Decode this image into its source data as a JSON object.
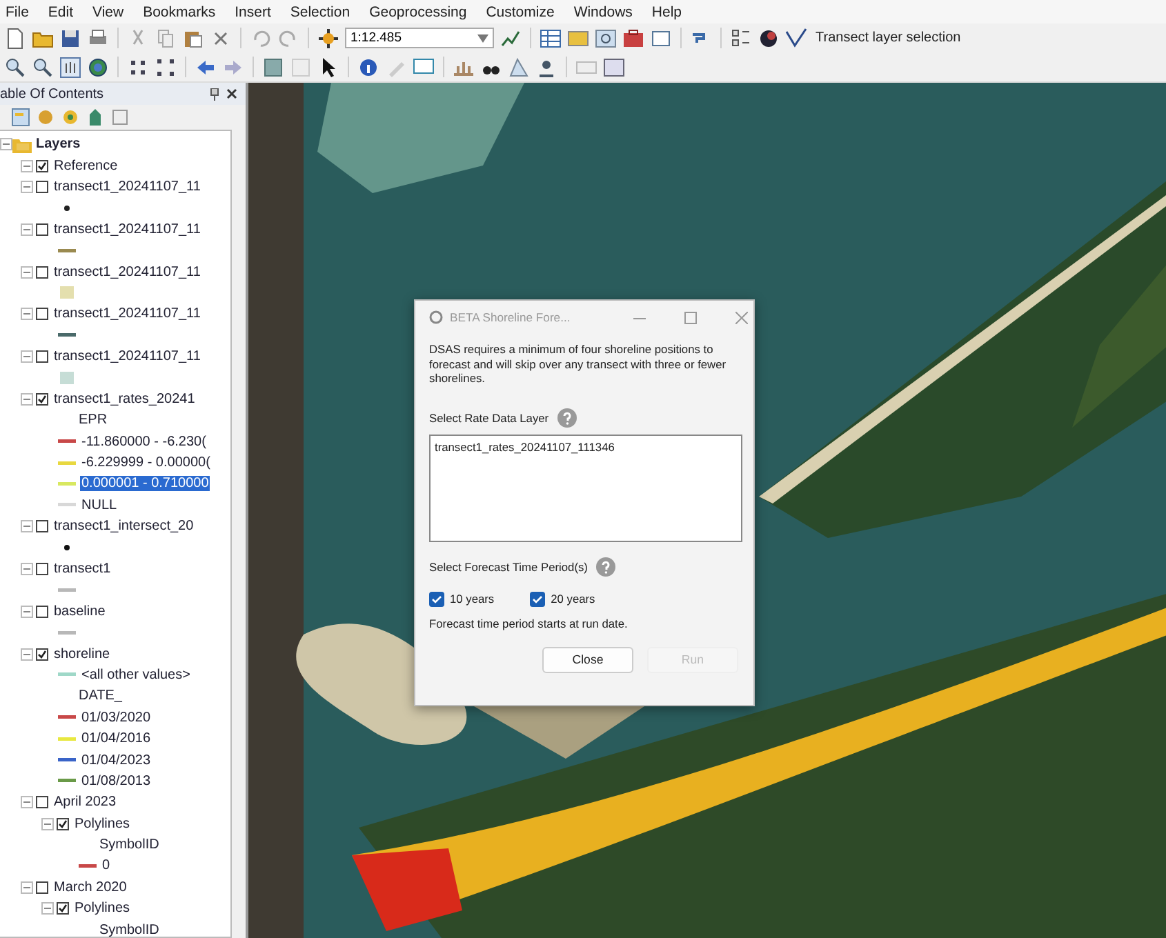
{
  "menu": [
    "File",
    "Edit",
    "View",
    "Bookmarks",
    "Insert",
    "Selection",
    "Geoprocessing",
    "Customize",
    "Windows",
    "Help"
  ],
  "toolbar": {
    "scale": "1:12.485",
    "tool_label": "Transect layer selection"
  },
  "toc": {
    "title": "able Of Contents",
    "layers": [
      {
        "kind": "group",
        "label": "Layers",
        "children": [
          {
            "kind": "layer",
            "label": "Reference",
            "checked": true
          },
          {
            "kind": "layer",
            "label": "transect1_20241107_11",
            "checked": false,
            "children": [
              {
                "kind": "dot",
                "color": "#222222"
              }
            ]
          },
          {
            "kind": "layer",
            "label": "transect1_20241107_11",
            "checked": false,
            "children": [
              {
                "kind": "line",
                "color": "#9a8a50"
              }
            ]
          },
          {
            "kind": "layer",
            "label": "transect1_20241107_11",
            "checked": false,
            "children": [
              {
                "kind": "patch",
                "color": "#e4dfae"
              }
            ]
          },
          {
            "kind": "layer",
            "label": "transect1_20241107_11",
            "checked": false,
            "children": [
              {
                "kind": "line",
                "color": "#4a6a6a"
              }
            ]
          },
          {
            "kind": "layer",
            "label": "transect1_20241107_11",
            "checked": false,
            "children": [
              {
                "kind": "patch",
                "color": "#c6ddd6"
              }
            ]
          },
          {
            "kind": "layer",
            "label": "transect1_rates_20241",
            "checked": true,
            "children": [
              {
                "kind": "field",
                "label": "EPR",
                "selected": false
              },
              {
                "kind": "line",
                "label": "-11.860000 - -6.230(",
                "color": "#c84848",
                "selected": false
              },
              {
                "kind": "line",
                "label": "-6.229999 - 0.00000(",
                "color": "#e8d840",
                "selected": false
              },
              {
                "kind": "line",
                "label": "0.000001 - 0.710000",
                "color": "#d8e860",
                "selected": true
              },
              {
                "kind": "line",
                "label": "NULL",
                "color": "#d8d8d8",
                "selected": false
              }
            ]
          },
          {
            "kind": "layer",
            "label": "transect1_intersect_20",
            "checked": false,
            "children": [
              {
                "kind": "dot",
                "color": "#111111"
              }
            ]
          },
          {
            "kind": "layer",
            "label": "transect1",
            "checked": false,
            "children": [
              {
                "kind": "line",
                "color": "#b8b8b8"
              }
            ]
          },
          {
            "kind": "layer",
            "label": "baseline",
            "checked": false,
            "children": [
              {
                "kind": "line",
                "color": "#b8b8b8"
              }
            ]
          },
          {
            "kind": "layer",
            "label": "shoreline",
            "checked": true,
            "children": [
              {
                "kind": "line",
                "label": "<all other values>",
                "color": "#9fd8c8"
              },
              {
                "kind": "field",
                "label": "DATE_"
              },
              {
                "kind": "line",
                "label": "01/03/2020",
                "color": "#c84848"
              },
              {
                "kind": "line",
                "label": "01/04/2016",
                "color": "#e8e840"
              },
              {
                "kind": "line",
                "label": "01/04/2023",
                "color": "#3a64c8"
              },
              {
                "kind": "line",
                "label": "01/08/2013",
                "color": "#6a9a48"
              }
            ]
          },
          {
            "kind": "layer",
            "label": "April 2023",
            "checked": false,
            "children": [
              {
                "kind": "layer",
                "label": "Polylines",
                "checked": true,
                "children": [
                  {
                    "kind": "field",
                    "label": "SymbolID"
                  },
                  {
                    "kind": "line",
                    "label": "0",
                    "color": "#c84848"
                  }
                ]
              }
            ]
          },
          {
            "kind": "layer",
            "label": "March 2020",
            "checked": false,
            "children": [
              {
                "kind": "layer",
                "label": "Polylines",
                "checked": true,
                "children": [
                  {
                    "kind": "field",
                    "label": "SymbolID"
                  }
                ]
              }
            ]
          }
        ]
      }
    ]
  },
  "dialog": {
    "title": "BETA Shoreline Fore...",
    "description": "DSAS requires a minimum of four shoreline positions to forecast and will skip over any transect with three or fewer shorelines.",
    "rate_label": "Select Rate Data Layer",
    "rate_layers": [
      "transect1_rates_20241107_111346"
    ],
    "period_label": "Select Forecast Time Period(s)",
    "periods": [
      {
        "label": "10 years",
        "checked": true
      },
      {
        "label": "20 years",
        "checked": true
      }
    ],
    "note": "Forecast time period starts at run date.",
    "buttons": [
      {
        "label": "Close",
        "disabled": false
      },
      {
        "label": "Run",
        "disabled": true
      }
    ]
  }
}
